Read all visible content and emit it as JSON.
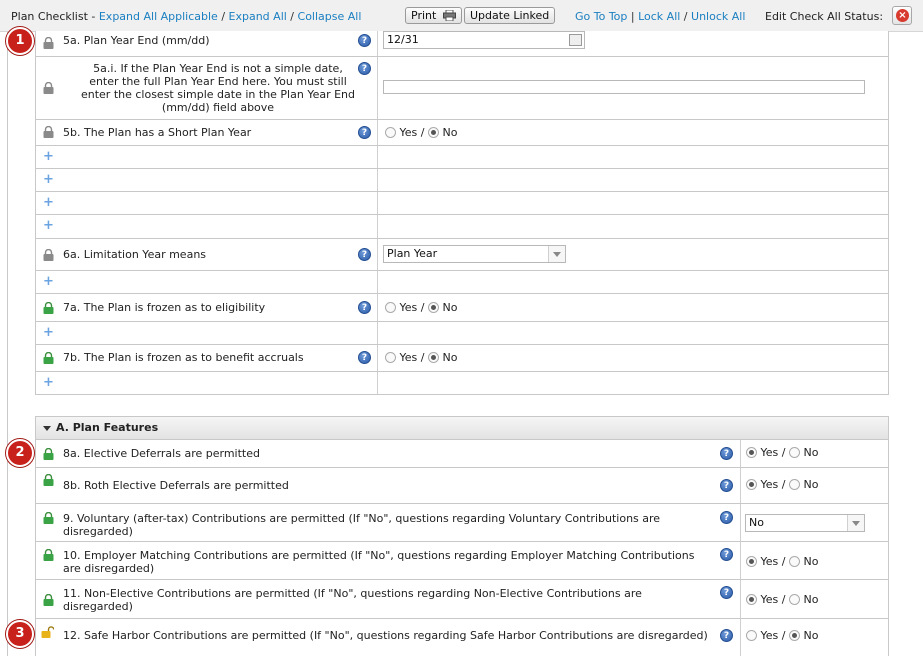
{
  "toolbar": {
    "title": "Plan Checklist - ",
    "expand_applicable": "Expand All Applicable",
    "slash1": " / ",
    "expand_all": "Expand All",
    "slash2": " / ",
    "collapse_all": "Collapse All",
    "print_label": "Print",
    "update_linked_label": "Update Linked",
    "go_to_top": "Go To Top",
    "pipe1": " | ",
    "lock_all": "Lock All",
    "slash3": " / ",
    "unlock_all": "Unlock All",
    "edit_status": "Edit Check All Status:"
  },
  "radio": {
    "yes": "Yes /",
    "no": "No"
  },
  "rows": {
    "r5a": {
      "text": "5a. Plan Year End (mm/dd)",
      "value": "12/31"
    },
    "r5ai": {
      "line1": "5a.i. If the Plan Year End is not a simple date,",
      "line2": "enter the full Plan Year End here. You must still",
      "line3": "enter the closest simple date in the Plan Year End",
      "line4": "(mm/dd) field above",
      "value": ""
    },
    "r5b": {
      "text": "5b. The Plan has a Short Plan Year",
      "selected": "No"
    },
    "r6a": {
      "text": "6a. Limitation Year means",
      "value": "Plan Year"
    },
    "r7a": {
      "text": "7a. The Plan is frozen as to eligibility",
      "selected": "No"
    },
    "r7b": {
      "text": "7b. The Plan is frozen as to benefit accruals",
      "selected": "No"
    }
  },
  "section": {
    "title": "A. Plan Features"
  },
  "features": {
    "f8a": {
      "text": "8a. Elective Deferrals are permitted",
      "selected": "Yes"
    },
    "f8b": {
      "text": "8b. Roth Elective Deferrals are permitted",
      "selected": "Yes"
    },
    "f9": {
      "line1": "9. Voluntary (after-tax) Contributions are permitted (If \"No\", questions regarding Voluntary Contributions are",
      "line2": "disregarded)",
      "value": "No"
    },
    "f10": {
      "line1": "10. Employer Matching Contributions are permitted (If \"No\", questions regarding Employer Matching Contributions",
      "line2": "are disregarded)",
      "selected": "Yes"
    },
    "f11": {
      "line1": "11. Non-Elective Contributions are permitted (If \"No\", questions regarding Non-Elective Contributions are",
      "line2": "disregarded)",
      "selected": "Yes"
    },
    "f12": {
      "text": "12. Safe Harbor Contributions are permitted (If \"No\", questions regarding Safe Harbor Contributions are disregarded)",
      "selected": "No"
    }
  },
  "markers": {
    "m1": "1",
    "m2": "2",
    "m3": "3"
  },
  "icons": {
    "help": "?",
    "plus": "+",
    "close": "×"
  },
  "colors": {
    "link": "#1a7fc1",
    "marker": "#c8211c",
    "lock_locked": "#8a8a8a",
    "lock_unlocked": "#3aa346",
    "lock_open_yellow": "#e8b21a"
  }
}
